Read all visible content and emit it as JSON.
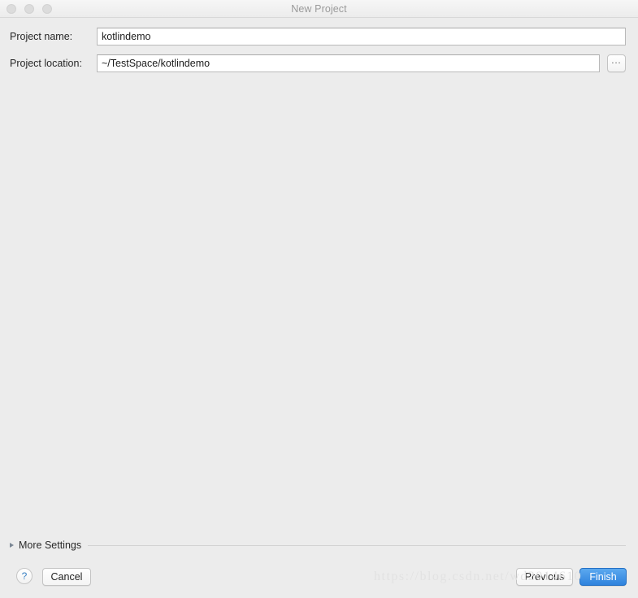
{
  "window": {
    "title": "New Project",
    "traffic_lights": [
      "close",
      "minimize",
      "zoom"
    ]
  },
  "form": {
    "fields": [
      {
        "label": "Project name:",
        "value": "kotlindemo",
        "placeholder": ""
      },
      {
        "label": "Project location:",
        "value": "~/TestSpace/kotlindemo",
        "placeholder": ""
      }
    ],
    "browse_label": "..."
  },
  "more_settings": {
    "label": "More Settings",
    "expanded": false
  },
  "buttons": {
    "help_label": "?",
    "cancel_label": "Cancel",
    "previous_label": "Previous",
    "finish_label": "Finish"
  },
  "watermark": {
    "text": "https://blog.csdn.net/wd2014610"
  },
  "colors": {
    "window_bg": "#ececec",
    "accent": "#2e82dd",
    "title_text": "#9a9a9a",
    "field_bg": "#ffffff"
  }
}
